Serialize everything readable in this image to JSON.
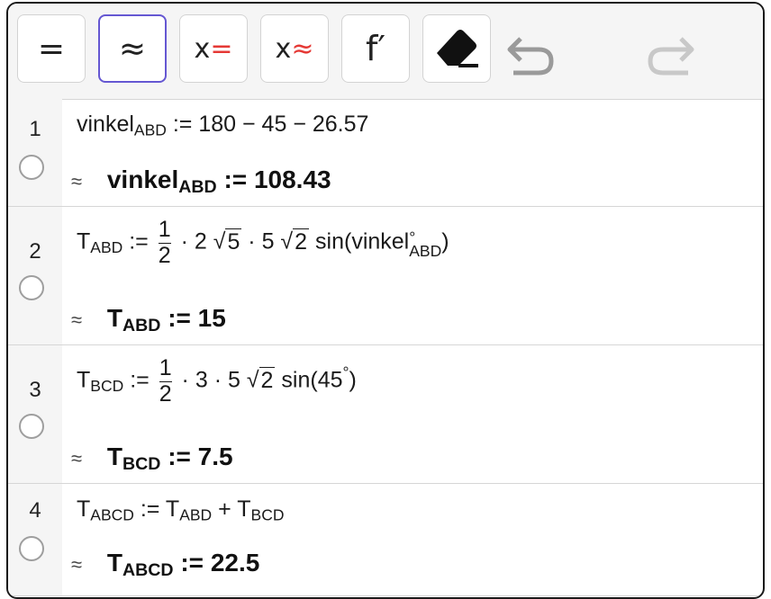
{
  "toolbar": {
    "equal": "=",
    "approx": "≈",
    "solve_x": "x",
    "solve_eq": "=",
    "nsolve_x": "x",
    "nsolve_eq": "≈",
    "derivative": "f′"
  },
  "rows": [
    {
      "num": "1",
      "input": {
        "lhs": "vinkel",
        "lhs_sub": "ABD",
        "assign": ":=",
        "expr": "180 − 45 − 26.57"
      },
      "output": {
        "approx": "≈",
        "lhs": "vinkel",
        "lhs_sub": "ABD",
        "assign": ":=",
        "value": "108.43"
      }
    },
    {
      "num": "2",
      "input": {
        "lhs": "T",
        "lhs_sub": "ABD",
        "assign": ":=",
        "frac_num": "1",
        "frac_den": "2",
        "dot1": "·",
        "c1": "2",
        "sqrt1": "5",
        "dot2": "·",
        "c2": "5",
        "sqrt2": "2",
        "fn": "sin(",
        "arg": "vinkel",
        "arg_sup": "°",
        "arg_sub": "ABD",
        "close": ")"
      },
      "output": {
        "approx": "≈",
        "lhs": "T",
        "lhs_sub": "ABD",
        "assign": ":=",
        "value": "15"
      }
    },
    {
      "num": "3",
      "input": {
        "lhs": "T",
        "lhs_sub": "BCD",
        "assign": ":=",
        "frac_num": "1",
        "frac_den": "2",
        "dot1": "·",
        "c1": "3",
        "dot2": "·",
        "c2": "5",
        "sqrt1": "2",
        "fn": "sin(45",
        "deg": "°",
        "close": ")"
      },
      "output": {
        "approx": "≈",
        "lhs": "T",
        "lhs_sub": "BCD",
        "assign": ":=",
        "value": "7.5"
      }
    },
    {
      "num": "4",
      "input": {
        "lhs": "T",
        "lhs_sub": "ABCD",
        "assign": ":=",
        "t1": "T",
        "t1_sub": "ABD",
        "plus": "+",
        "t2": "T",
        "t2_sub": "BCD"
      },
      "output": {
        "approx": "≈",
        "lhs": "T",
        "lhs_sub": "ABCD",
        "assign": ":=",
        "value": "22.5"
      }
    }
  ]
}
